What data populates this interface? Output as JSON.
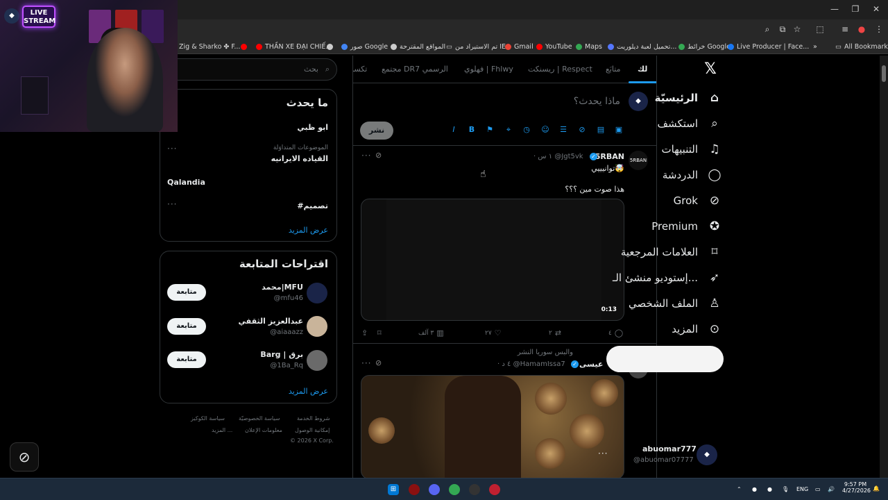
{
  "browser": {
    "bookmarks": [
      {
        "label": "Zig & Sharko ✤ F..."
      },
      {
        "label": ""
      },
      {
        "label": "THẦN XE ĐẠI CHIẾ..."
      },
      {
        "label": ""
      },
      {
        "label": "صور Google"
      },
      {
        "label": "المواقع المقترحة"
      },
      {
        "label": "تم الاستيراد من IE"
      },
      {
        "label": "Gmail"
      },
      {
        "label": "YouTube"
      },
      {
        "label": "Maps"
      },
      {
        "label": "تحميل لعبة ديلوريت..."
      },
      {
        "label": "خرائط Google"
      },
      {
        "label": "Live Producer | Face..."
      },
      {
        "label": "All Bookmarks"
      }
    ]
  },
  "webcam": {
    "badge_line1": "LIVE",
    "badge_line2": "STREAM"
  },
  "nav": {
    "logo": "𝕏",
    "items": [
      {
        "label": "الرئيسيّة",
        "icon": "home-icon"
      },
      {
        "label": "استكشف",
        "icon": "search-icon"
      },
      {
        "label": "التنبيهات",
        "icon": "bell-icon"
      },
      {
        "label": "الدردشة",
        "icon": "chat-icon"
      },
      {
        "label": "Grok",
        "icon": "grok-icon"
      },
      {
        "label": "Premium",
        "icon": "premium-icon"
      },
      {
        "label": "العلامات المرجعية",
        "icon": "bookmark-icon"
      },
      {
        "label": "إستوديو منشئ الـ...",
        "icon": "rocket-icon"
      },
      {
        "label": "الملف الشخصي",
        "icon": "profile-icon"
      },
      {
        "label": "المزيد",
        "icon": "more-icon"
      }
    ],
    "account": {
      "name": "abuomar777",
      "handle": "@abuomar07777"
    }
  },
  "timeline": {
    "tabs": [
      {
        "label": "لك"
      },
      {
        "label": "متابَع"
      },
      {
        "label": "ريسنكت | Respect"
      },
      {
        "label": "فهلوي | Fhlwy"
      },
      {
        "label": "مجتمع DR7 الرسمي"
      },
      {
        "label": "تكسا"
      }
    ],
    "compose_placeholder": "ماذا يحدث؟",
    "post_button": "نشر",
    "tweets": [
      {
        "name": "5RBAN",
        "handle": "@Jgt5vk",
        "time": "· ١ س",
        "line1": "توانيييي🤯",
        "line2": "هذا صوت مين ؟؟؟",
        "video_duration": "0:13",
        "replies": "٤",
        "retweets": "٢",
        "likes": "٢٧",
        "views": "٣ آلف"
      },
      {
        "context": "والبس سوريا النشر",
        "name": "عيسى",
        "handle": "@HamamIssa7",
        "time": "· ٤ د"
      }
    ]
  },
  "sidebar": {
    "search_placeholder": "بحث",
    "trends_title": "ما يحدث",
    "trends": [
      {
        "meta": "",
        "name": "ابو ظبي"
      },
      {
        "meta": "الموضوعات المتداوَلة",
        "name": "القياده الايرانيه"
      },
      {
        "meta": "",
        "name": "Qalandia"
      },
      {
        "meta": "",
        "name": "#تصميم"
      }
    ],
    "show_more": "عرض المزيد",
    "suggest_title": "اقتراحات المتابعة",
    "suggestions": [
      {
        "name": "محمد|MFU",
        "handle": "@mfu46",
        "button": "متابعة"
      },
      {
        "name": "عبدالعزيز الثقفي",
        "handle": "@aiaaazz",
        "button": "متابعة"
      },
      {
        "name": "Barg | برق",
        "handle": "@1Ba_Rq",
        "button": "متابعة"
      }
    ],
    "footer": [
      "شروط الخدمة",
      "سياسة الخصوصيّة",
      "سياسة الكوكيز",
      "إمكانية الوصول",
      "معلومات الإعلان",
      "المزيد ...",
      "© 2026 X Corp."
    ]
  },
  "taskbar": {
    "lang": "ENG",
    "time": "9:57 PM",
    "date": "4/27/2026"
  }
}
